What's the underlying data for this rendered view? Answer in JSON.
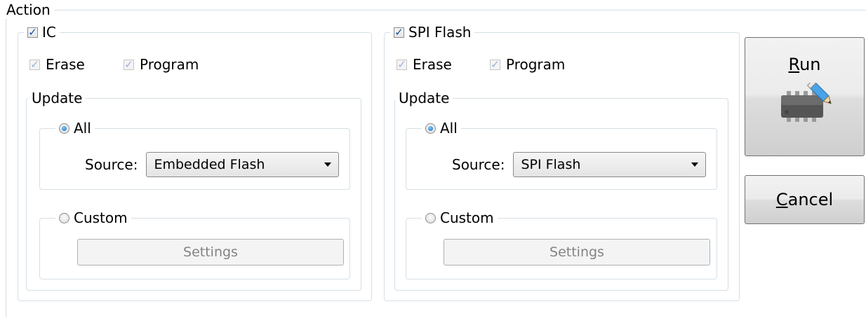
{
  "action": {
    "legend": "Action",
    "ic": {
      "label": "IC",
      "checked": true,
      "erase_label": "Erase",
      "program_label": "Program",
      "update": {
        "legend": "Update",
        "all_label": "All",
        "source_label": "Source:",
        "source_value": "Embedded Flash",
        "custom_label": "Custom",
        "settings_label": "Settings"
      }
    },
    "spi": {
      "label": "SPI Flash",
      "checked": true,
      "erase_label": "Erase",
      "program_label": "Program",
      "update": {
        "legend": "Update",
        "all_label": "All",
        "source_label": "Source:",
        "source_value": "SPI Flash",
        "custom_label": "Custom",
        "settings_label": "Settings"
      }
    },
    "run": {
      "mnemonic": "R",
      "rest": "un",
      "icon": "chip-pencil-icon"
    },
    "cancel": {
      "mnemonic": "C",
      "rest": "ancel"
    }
  },
  "colors": {
    "border": "#d5dfe5",
    "check": "#1a4fa0",
    "radio": "#1c63b8"
  }
}
